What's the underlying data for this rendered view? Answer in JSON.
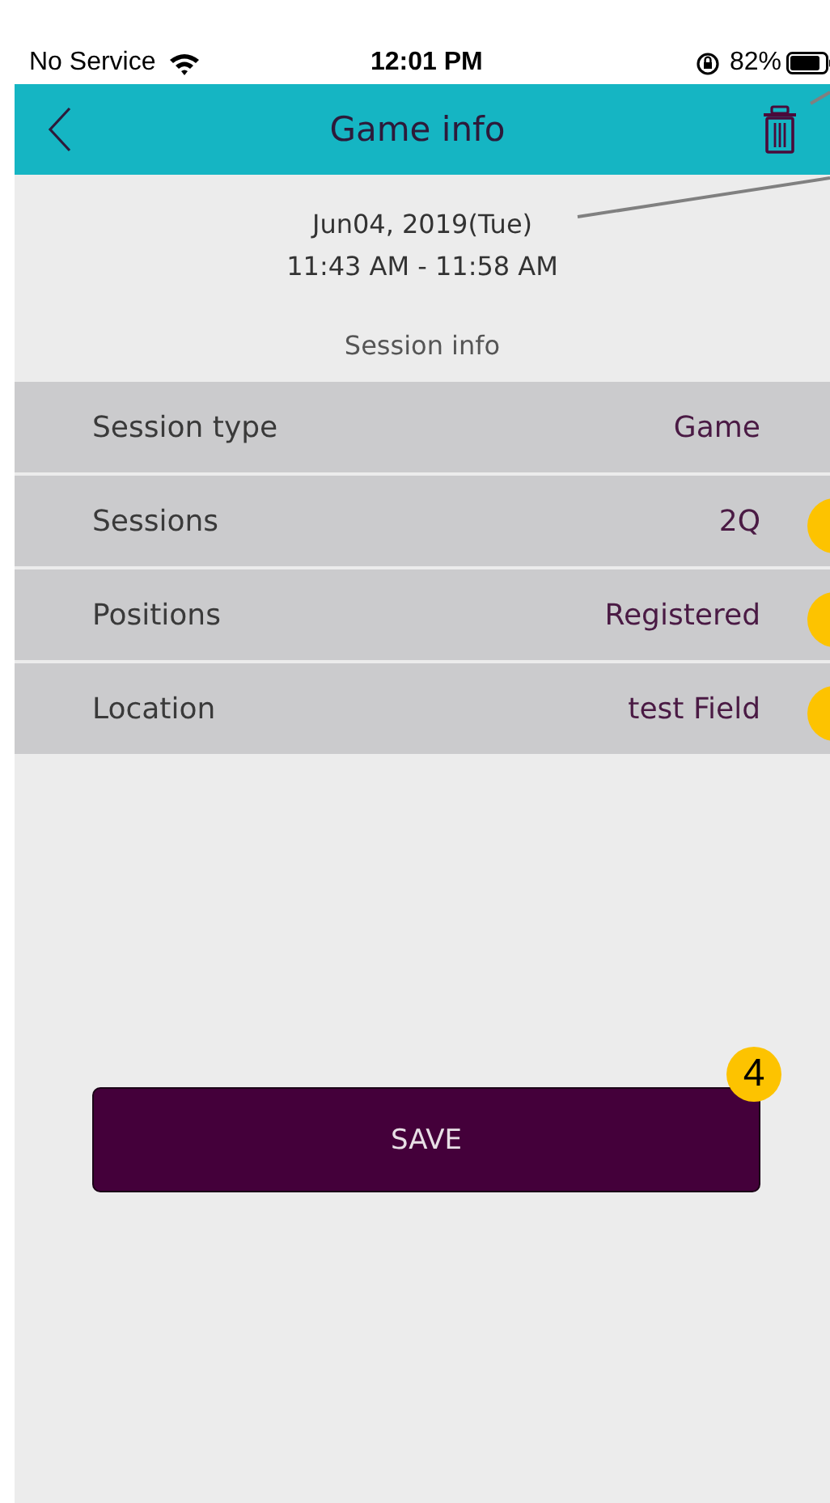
{
  "status_bar": {
    "carrier": "No Service",
    "time": "12:01 PM",
    "battery": "82%"
  },
  "header": {
    "title": "Game info"
  },
  "date": "Jun04, 2019(Tue)",
  "time_range": "11:43 AM - 11:58 AM",
  "section_title": "Session info",
  "rows": [
    {
      "label": "Session type",
      "value": "Game"
    },
    {
      "label": "Sessions",
      "value": "2Q",
      "callout_marker": true
    },
    {
      "label": "Positions",
      "value": "Registered",
      "callout_marker": true
    },
    {
      "label": "Location",
      "value": "test Field",
      "callout_marker": true
    }
  ],
  "save_button": {
    "label": "SAVE",
    "callout": "4"
  }
}
